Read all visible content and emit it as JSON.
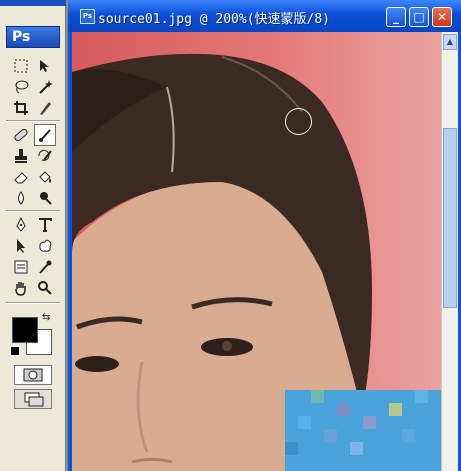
{
  "toolbox": {
    "title": "Ps",
    "tools": [
      "rectangular-marquee-tool",
      "move-tool",
      "lasso-tool",
      "magic-wand-tool",
      "crop-tool",
      "slice-tool",
      "healing-brush-tool",
      "brush-tool",
      "clone-stamp-tool",
      "history-brush-tool",
      "eraser-tool",
      "paint-bucket-tool",
      "blur-tool",
      "dodge-tool",
      "pen-tool",
      "type-tool",
      "path-selection-tool",
      "custom-shape-tool",
      "notes-tool",
      "eyedropper-tool",
      "hand-tool",
      "zoom-tool"
    ],
    "active_tool": "brush-tool",
    "foreground_color": "#000000",
    "background_color": "#ffffff",
    "mode": "quick-mask"
  },
  "window": {
    "title": "source01.jpg @ 200%(快速蒙版/8)",
    "minimize_label": "_",
    "maximize_label": "□",
    "close_label": "✕"
  },
  "colors": {
    "titlebar": "#0a4fd6",
    "quick_mask_overlay": "#d7595c"
  }
}
